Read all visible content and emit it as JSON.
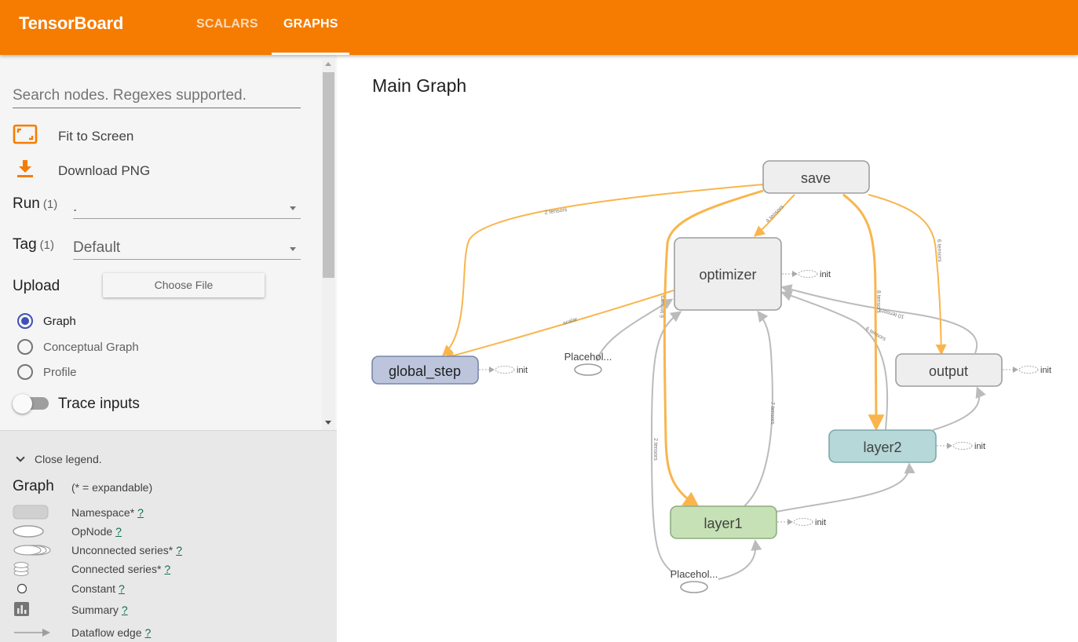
{
  "header": {
    "brand": "TensorBoard",
    "tabs": [
      {
        "label": "SCALARS",
        "active": false
      },
      {
        "label": "GRAPHS",
        "active": true
      }
    ],
    "accent_color": "#f57c00"
  },
  "sidebar": {
    "search_placeholder": "Search nodes. Regexes supported.",
    "fit_to_screen": {
      "label": "Fit to Screen",
      "icon": "fit-screen-icon"
    },
    "download_png": {
      "label": "Download PNG",
      "icon": "download-icon"
    },
    "run": {
      "label": "Run",
      "count": "(1)",
      "value": "."
    },
    "tag": {
      "label": "Tag",
      "count": "(1)",
      "value": "Default"
    },
    "upload": {
      "label": "Upload",
      "button": "Choose File"
    },
    "graph_types": [
      {
        "label": "Graph",
        "checked": true
      },
      {
        "label": "Conceptual Graph",
        "checked": false
      },
      {
        "label": "Profile",
        "checked": false
      }
    ],
    "trace_inputs": {
      "label": "Trace inputs",
      "on": false
    }
  },
  "legend": {
    "toggle_label": "Close legend.",
    "title": "Graph",
    "note": "(* = expandable)",
    "items": [
      {
        "label": "Namespace*",
        "help": "?",
        "icon": "namespace-icon"
      },
      {
        "label": "OpNode",
        "help": "?",
        "icon": "opnode-icon"
      },
      {
        "label": "Unconnected series*",
        "help": "?",
        "icon": "unconnected-series-icon"
      },
      {
        "label": "Connected series*",
        "help": "?",
        "icon": "connected-series-icon"
      },
      {
        "label": "Constant",
        "help": "?",
        "icon": "constant-icon"
      },
      {
        "label": "Summary",
        "help": "?",
        "icon": "summary-icon"
      },
      {
        "label": "Dataflow edge",
        "help": "?",
        "icon": "dataflow-edge-icon"
      }
    ]
  },
  "main": {
    "title": "Main Graph",
    "nodes": {
      "save": "save",
      "optimizer": "optimizer",
      "global_step": "global_step",
      "output": "output",
      "layer2": "layer2",
      "layer1": "layer1",
      "placeholder_top": "Placehol...",
      "placeholder_bottom": "Placehol..."
    },
    "init_label": "init",
    "edge_labels": {
      "save_to_global": "2 tensors",
      "save_to_opt": "4 tensors",
      "save_to_output": "6 tensors",
      "save_to_layer2": "8 tensors",
      "opt_to_global": "scalar",
      "save_to_layer1": "6 tensors",
      "layer1_to_opt": "7 tensors",
      "placeholder_to_opt": "2 tensors",
      "output_to_opt": "10 tensors",
      "layer2_to_opt": "6 tensors"
    },
    "colors": {
      "namespace_fill": "#eeeeee",
      "global_step_fill": "#bcc5dc",
      "layer2_fill": "#b6d8d8",
      "layer1_fill": "#c5e1b5",
      "edge_ref": "#f9b54c",
      "edge_data": "#bbbbbb"
    }
  }
}
